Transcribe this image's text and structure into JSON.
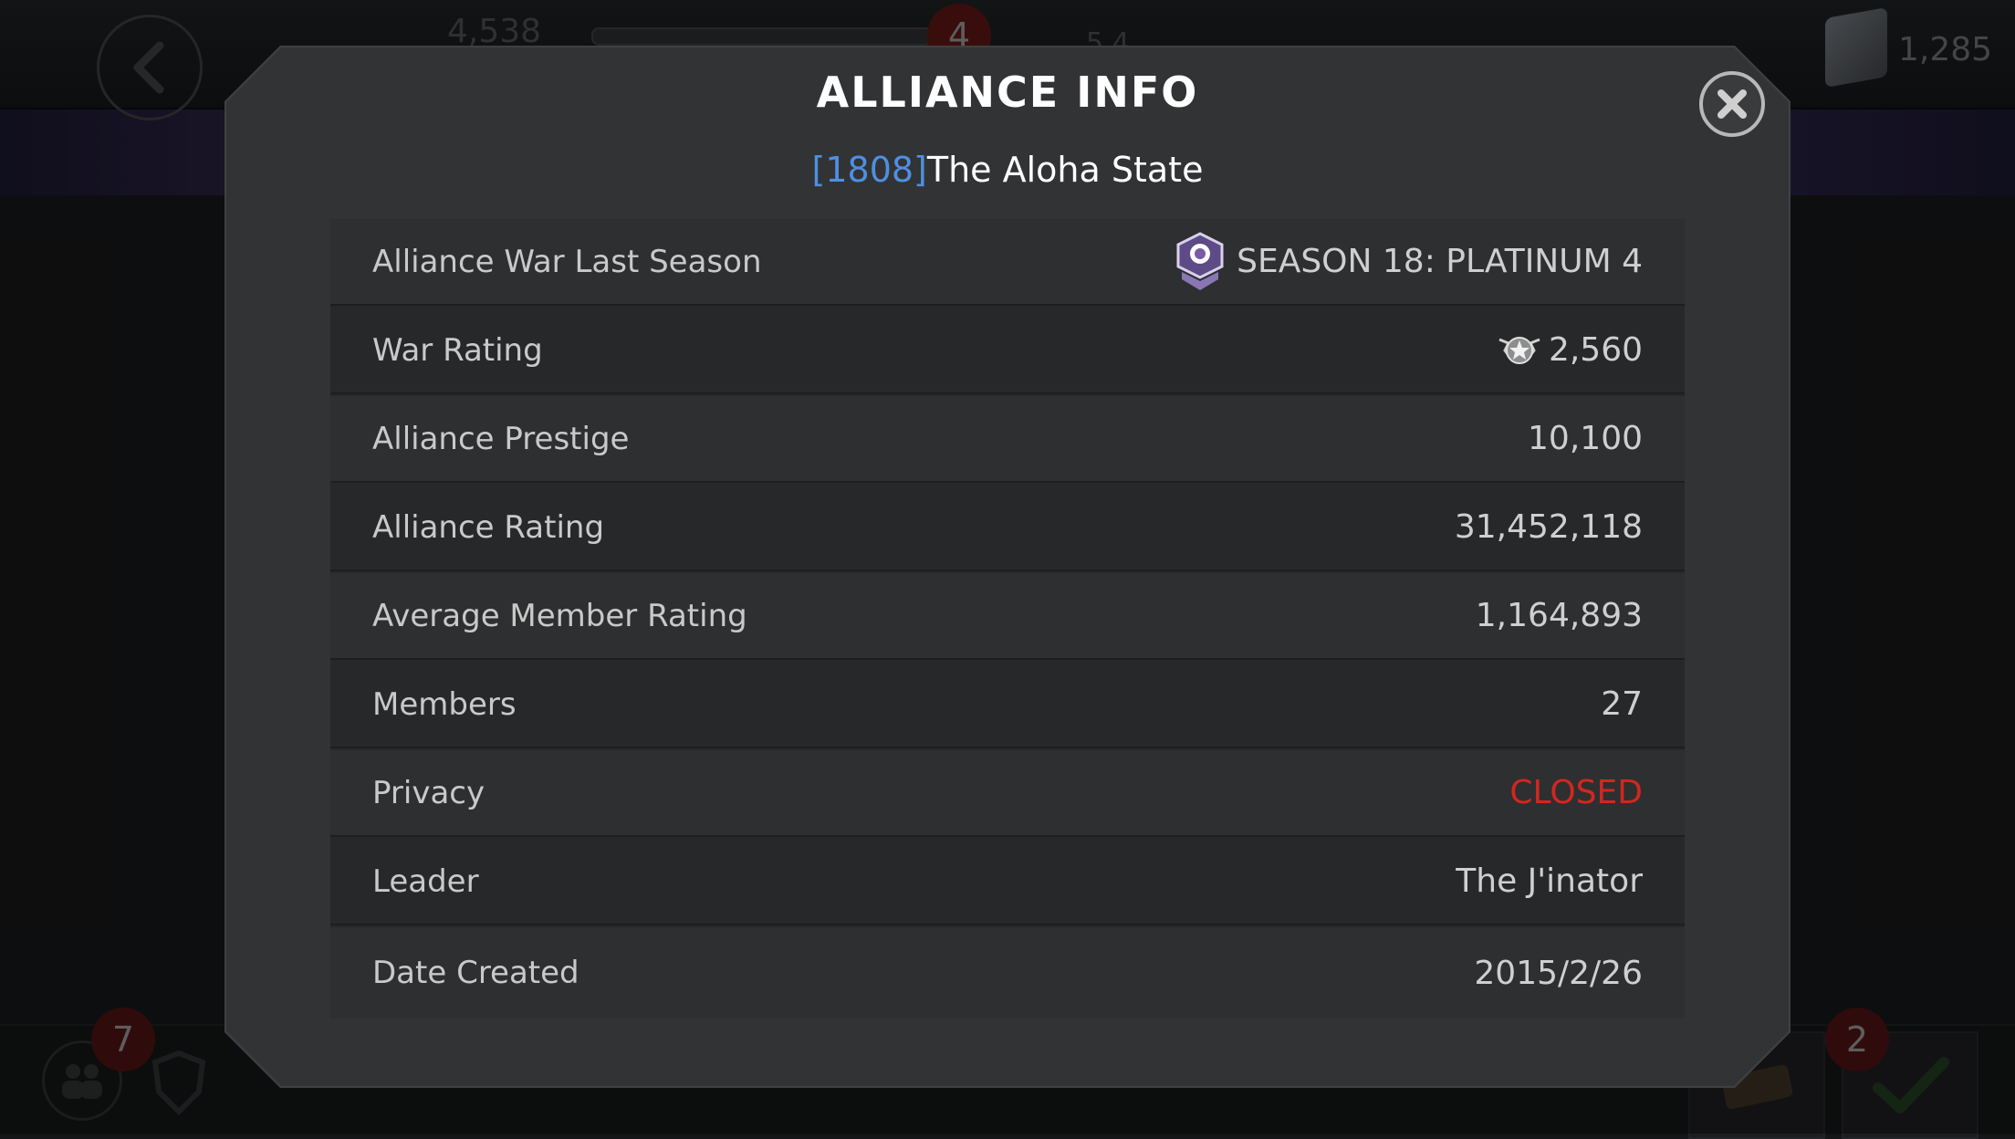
{
  "background": {
    "hud": {
      "currency_left": "4,538",
      "badge_top_center": "4",
      "currency_mid": "5,4",
      "gold_amount": "1,285"
    },
    "bottom": {
      "members_badge": "7",
      "tasks_badge": "2"
    }
  },
  "modal": {
    "title": "ALLIANCE INFO",
    "alliance_tag": "[1808]",
    "alliance_name": "The Aloha State",
    "close_icon": "close-icon",
    "rows": [
      {
        "label": "Alliance War Last Season",
        "value": "SEASON 18: PLATINUM 4",
        "icon": "platinum-tier-icon"
      },
      {
        "label": "War Rating",
        "value": "2,560",
        "icon": "war-rating-icon"
      },
      {
        "label": "Alliance Prestige",
        "value": "10,100"
      },
      {
        "label": "Alliance Rating",
        "value": "31,452,118"
      },
      {
        "label": "Average Member Rating",
        "value": "1,164,893"
      },
      {
        "label": "Members",
        "value": "27"
      },
      {
        "label": "Privacy",
        "value": "CLOSED",
        "color": "#d2271e"
      },
      {
        "label": "Leader",
        "value": "The J'inator"
      },
      {
        "label": "Date Created",
        "value": "2015/2/26"
      }
    ]
  },
  "colors": {
    "tag_blue": "#4f8fe0",
    "closed_red": "#d2271e",
    "modal_bg": "#323335",
    "table_bg": "#272829"
  }
}
